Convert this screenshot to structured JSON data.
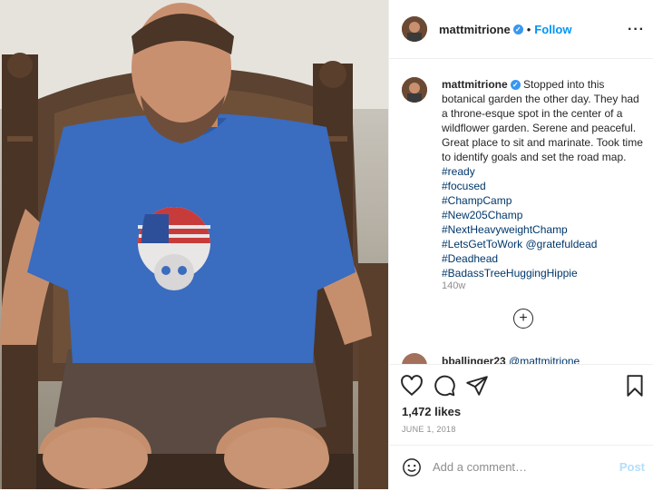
{
  "post": {
    "username": "mattmitrione",
    "verified_mark": "✓",
    "dot": "•",
    "follow_label": "Follow",
    "more_label": "···",
    "photo_subject": "man in blue t-shirt seated on carved wooden throne"
  },
  "caption": {
    "username": "mattmitrione",
    "text": "Stopped into this botanical garden the other day. They had a throne-esque spot in the center of a wildflower garden. Serene and peaceful. Great place to sit and marinate. Took time to identify goals and set the road map.",
    "first_tag": "#ready",
    "tags": [
      "#focused",
      "#ChampCamp",
      "#New205Champ",
      "#NextHeavyweightChamp"
    ],
    "last_line_tag": "#LetsGetToWork",
    "last_line_mention": "@gratefuldead",
    "tags_after": [
      "#Deadhead",
      "#BadassTreeHuggingHippie"
    ],
    "time_ago": "140w",
    "load_more": "+"
  },
  "next_comment": {
    "username": "bballinger23",
    "mention": "@mattmitrione"
  },
  "actions": {
    "icons": [
      "heart-icon",
      "comment-icon",
      "share-icon",
      "bookmark-icon"
    ],
    "likes": "1,472 likes",
    "date": "JUNE 1, 2018"
  },
  "comment_box": {
    "placeholder": "Add a comment…",
    "post_label": "Post",
    "emoji_icon": "smiley-icon"
  },
  "colors": {
    "link_blue": "#0095f6",
    "hashtag": "#00376b",
    "muted": "#8e8e8e",
    "border": "#efefef",
    "shirt": "#3a6cc0"
  }
}
